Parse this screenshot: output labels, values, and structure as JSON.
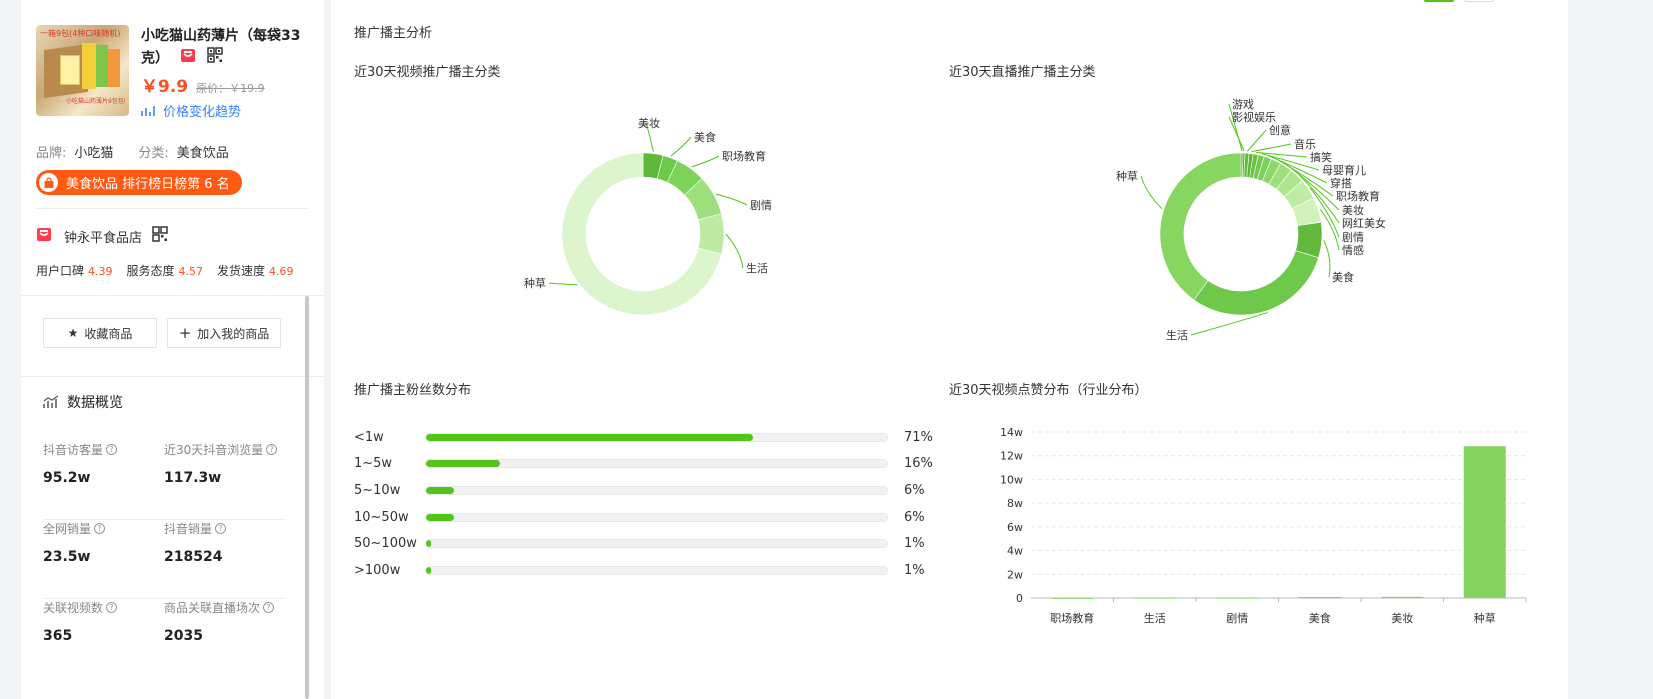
{
  "product": {
    "title": "小吃猫山药薄片（每袋33克）",
    "thumb_text": "一箱9包(4种口味随机)",
    "thumb_bottom": "小吃猫山药薄片9包包邮",
    "price": "￥9.9",
    "original_price": "原价：￥19.9",
    "trend_link": "价格变化趋势",
    "brand_label": "品牌:",
    "brand_value": "小吃猫",
    "category_label": "分类:",
    "category_value": "美食饮品",
    "rank_badge": "美食饮品 排行榜日榜第 6 名"
  },
  "shop": {
    "name": "钟永平食品店",
    "scores": [
      {
        "label": "用户口碑",
        "value": "4.39"
      },
      {
        "label": "服务态度",
        "value": "4.57"
      },
      {
        "label": "发货速度",
        "value": "4.69"
      }
    ]
  },
  "actions": {
    "favorite": "收藏商品",
    "add": "加入我的商品"
  },
  "overview": {
    "title": "数据概览",
    "stats": [
      {
        "label": "抖音访客量",
        "value": "95.2w"
      },
      {
        "label": "近30天抖音浏览量",
        "value": "117.3w"
      },
      {
        "label": "全网销量",
        "value": "23.5w"
      },
      {
        "label": "抖音销量",
        "value": "218524"
      },
      {
        "label": "关联视频数",
        "value": "365"
      },
      {
        "label": "商品关联直播场次",
        "value": "2035"
      }
    ]
  },
  "main": {
    "title": "推广播主分析",
    "video_donut_title": "近30天视频推广播主分类",
    "live_donut_title": "近30天直播推广播主分类",
    "fans_title": "推广播主粉丝数分布",
    "likes_title": "近30天视频点赞分布（行业分布）"
  },
  "colors": {
    "accent": "#52c41a",
    "price": "#ff4d1c",
    "link": "#3b82f6",
    "bar": "#85d35f"
  },
  "fans": [
    {
      "label": "<1w",
      "value": 71,
      "pct": "71%"
    },
    {
      "label": "1~5w",
      "value": 16,
      "pct": "16%"
    },
    {
      "label": "5~10w",
      "value": 6,
      "pct": "6%"
    },
    {
      "label": "10~50w",
      "value": 6,
      "pct": "6%"
    },
    {
      "label": "50~100w",
      "value": 1,
      "pct": "1%"
    },
    {
      "label": ">100w",
      "value": 1,
      "pct": "1%"
    }
  ],
  "chart_data": [
    {
      "type": "pie",
      "title": "近30天视频推广播主分类",
      "categories": [
        "美妆",
        "美食",
        "职场教育",
        "剧情",
        "生活",
        "种草"
      ],
      "values": [
        4,
        3,
        6,
        8,
        8,
        71
      ]
    },
    {
      "type": "pie",
      "title": "近30天直播推广播主分类",
      "categories": [
        "游戏",
        "影视娱乐",
        "创意",
        "音乐",
        "搞笑",
        "母婴育儿",
        "穿搭",
        "职场教育",
        "美妆",
        "网红美女",
        "剧情",
        "情感",
        "美食",
        "生活",
        "种草"
      ],
      "values": [
        0.4,
        0.4,
        0.8,
        0.8,
        1,
        1.2,
        1.5,
        2,
        2.5,
        3,
        4,
        5,
        7,
        30,
        40
      ]
    },
    {
      "type": "bar",
      "title": "近30天视频点赞分布（行业分布）",
      "categories": [
        "职场教育",
        "生活",
        "剧情",
        "美食",
        "美妆",
        "种草"
      ],
      "values": [
        0,
        0.02,
        0.02,
        0.08,
        0.1,
        12.8
      ],
      "ylim": [
        0,
        14
      ],
      "yticks": [
        "0",
        "2w",
        "4w",
        "6w",
        "8w",
        "10w",
        "12w",
        "14w"
      ]
    }
  ]
}
